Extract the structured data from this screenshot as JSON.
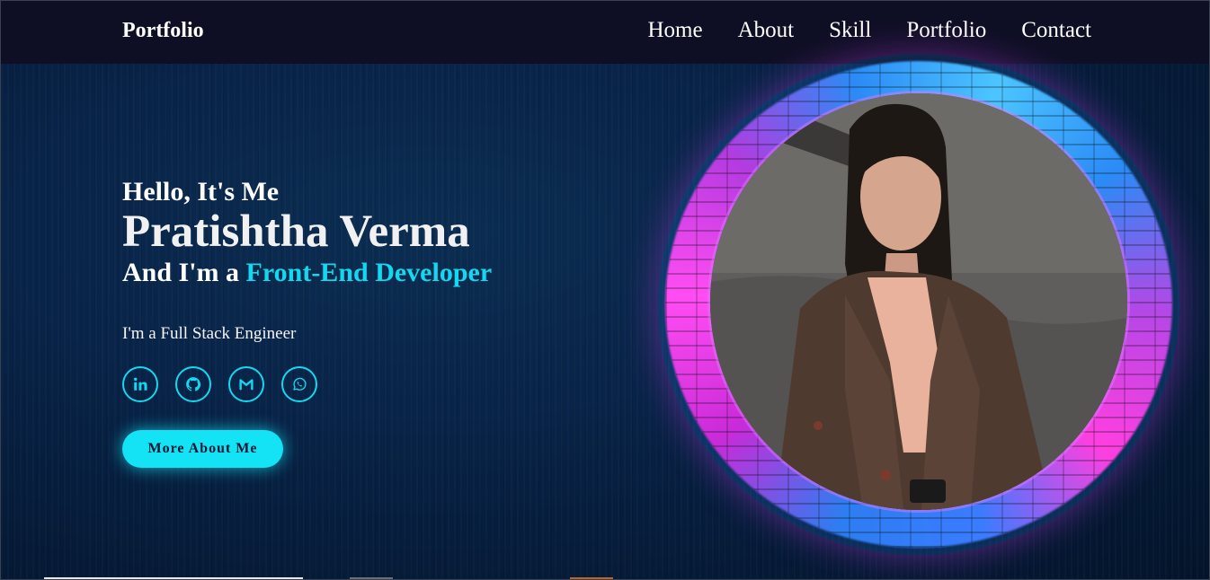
{
  "nav": {
    "logo": "Portfolio",
    "links": [
      "Home",
      "About",
      "Skill",
      "Portfolio",
      "Contact"
    ]
  },
  "hero": {
    "greeting": "Hello, It's Me",
    "name": "Pratishtha Verma",
    "role_prefix": "And I'm a ",
    "role": "Front-End Developer",
    "subtitle": "I'm a Full Stack Engineer",
    "socials": [
      "linkedin-icon",
      "github-icon",
      "gmail-icon",
      "whatsapp-icon"
    ],
    "cta_label": "More About Me"
  },
  "colors": {
    "accent": "#13d9f0",
    "navbar_bg": "#0e0f24",
    "page_bg": "#061a33",
    "ring_pink": "#ff4df2",
    "ring_blue": "#2b8bf5"
  }
}
